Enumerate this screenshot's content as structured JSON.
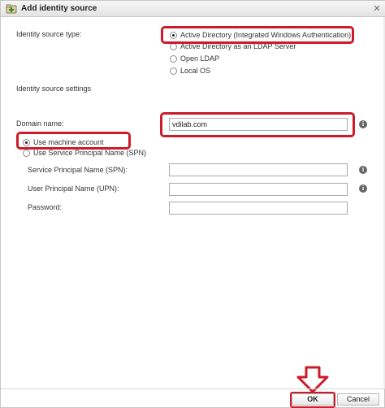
{
  "dialog": {
    "title": "Add identity source",
    "title_icon": "add-directory-icon",
    "close_icon": "close-icon"
  },
  "identity_source": {
    "type_label": "Identity source type:",
    "options": [
      "Active Directory (Integrated Windows Authentication)",
      "Active Directory as an LDAP Server",
      "Open LDAP",
      "Local OS"
    ],
    "selected": "Active Directory (Integrated Windows Authentication)"
  },
  "settings": {
    "heading": "Identity source settings",
    "domain_label": "Domain name:",
    "domain_value": "vdilab.com",
    "auth_options": [
      "Use machine account",
      "Use Service Principal Name (SPN)"
    ],
    "auth_selected": "Use machine account",
    "spn_label": "Service Principal Name (SPN):",
    "spn_value": "",
    "upn_label": "User Principal Name (UPN):",
    "upn_value": "",
    "password_label": "Password:",
    "password_value": ""
  },
  "icons": {
    "info": "info-icon",
    "annotation_arrow": "down-arrow-icon"
  },
  "footer": {
    "ok_label": "OK",
    "cancel_label": "Cancel"
  },
  "colors": {
    "highlight": "#cc1b2b",
    "titlebar": "#e9e9e9"
  }
}
